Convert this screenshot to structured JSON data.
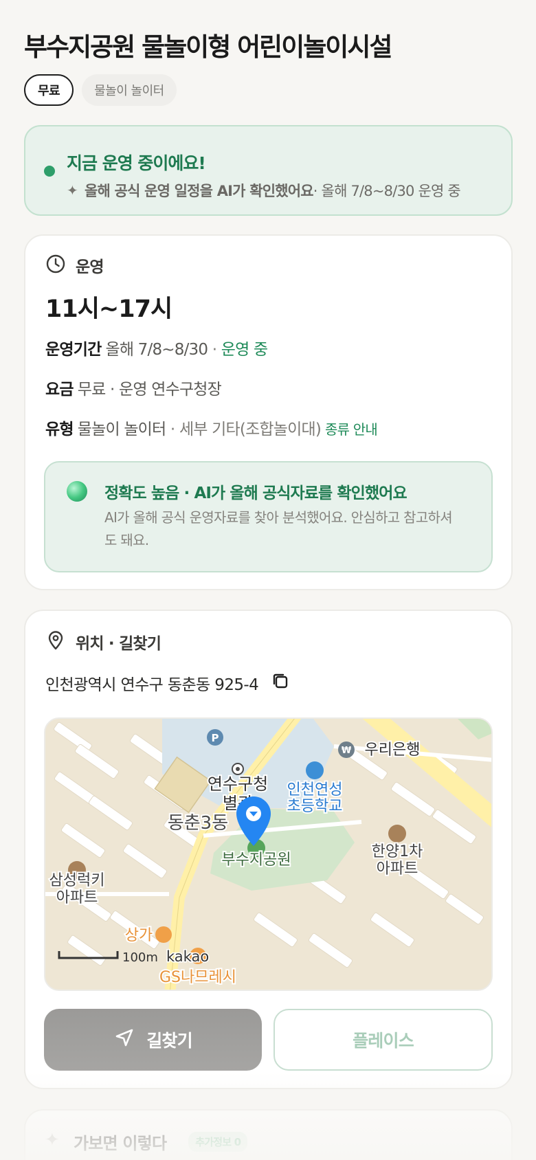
{
  "header": {
    "title": "부수지공원 물놀이형 어린이놀이시설",
    "chip_free": "무료",
    "chip_type": "물놀이 놀이터"
  },
  "status": {
    "title": "지금 운영 중이에요!",
    "sub_bold": "올해 공식 운영 일정을 AI가 확인했어요",
    "sub_rest": " · 올해 7/8~8/30 운영 중"
  },
  "operation": {
    "section_label": "운영",
    "hours": "11시~17시",
    "period_key": "운영기간",
    "period_value": "올해 7/8~8/30",
    "period_sep": " · ",
    "period_status": "운영 중",
    "fee_key": "요금",
    "fee_value": "무료 · 운영 연수구청장",
    "type_key": "유형",
    "type_value": "물놀이 놀이터",
    "type_detail": " · 세부 기타(조합놀이대)",
    "type_link": "종류 안내",
    "accuracy_title": "정확도 높음 · AI가 올해 공식자료를 확인했어요",
    "accuracy_desc": "AI가 올해 공식 운영자료를 찾아 분석했어요. 안심하고 참고하셔도 돼요."
  },
  "location": {
    "section_label": "위치 · 길찾기",
    "address": "인천광역시 연수구 동춘동 925-4",
    "map_labels": {
      "bank": "우리은행",
      "office_1": "연수구청",
      "office_2": "별관",
      "school_1": "인천연성",
      "school_2": "초등학교",
      "district": "동춘3동",
      "park": "부수지공원",
      "apt_hanyang_1": "한양1차",
      "apt_hanyang_2": "아파트",
      "apt_samsung_1": "삼성럭키",
      "apt_samsung_2": "아파트",
      "shop": "상가",
      "gs": "GS나므레시",
      "scale": "100m",
      "brand": "kakao"
    },
    "route_button": "길찾기",
    "place_button": "플레이스"
  },
  "teaser": {
    "title": "가보면 이렇다",
    "badge": "추가정보 0"
  },
  "colors": {
    "accent_green": "#1e7a50",
    "status_bg": "#e8f2ec",
    "marker_blue": "#2486f2"
  }
}
